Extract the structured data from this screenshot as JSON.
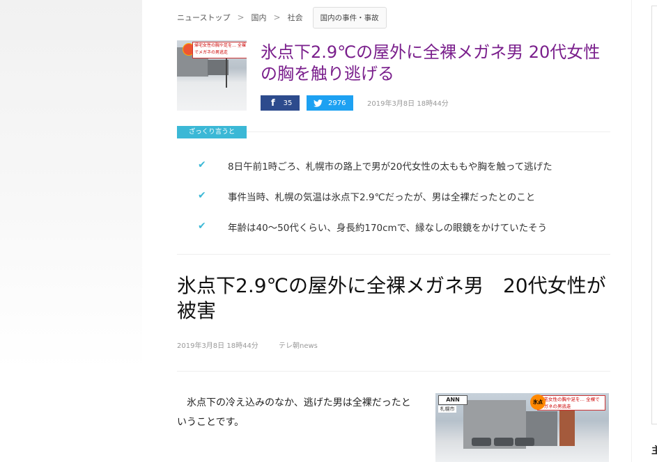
{
  "breadcrumb": {
    "items": [
      "ニューストップ",
      "国内",
      "社会"
    ],
    "separator": ">",
    "tag": "国内の事件・事故"
  },
  "headline": {
    "text": "氷点下2.9℃の屋外に全裸メガネ男 20代女性の胸を触り逃げる",
    "color": "#7a1f8c"
  },
  "thumbnail": {
    "caption": "帰宅女性の胸や足を… 全裸でメガネの男逃走"
  },
  "share": {
    "facebook_count": "35",
    "twitter_count": "2976"
  },
  "published": "2019年3月8日 18時44分",
  "summary": {
    "label": "ざっくり言うと",
    "accent_color": "#3bb8d6",
    "items": [
      "8日午前1時ごろ、札幌市の路上で男が20代女性の太ももや胸を触って逃げた",
      "事件当時、札幌の気温は氷点下2.9℃だったが、男は全裸だったとのこと",
      "年齢は40～50代くらい、身長約170cmで、縁なしの眼鏡をかけていたそう"
    ]
  },
  "article": {
    "title": "氷点下2.9℃の屋外に全裸メガネ男　20代女性が被害",
    "date": "2019年3月8日 18時44分",
    "source": "テレ朝news",
    "body": "氷点下の冷え込みのなか、逃げた男は全裸だったということです。"
  },
  "photo": {
    "logo": "ANN",
    "location": "札幌市",
    "badge": "氷点",
    "caption": "帰宅女性の胸や足を… 全裸でメガネの男逃走"
  },
  "sidebar": {
    "heading_char": "主"
  }
}
